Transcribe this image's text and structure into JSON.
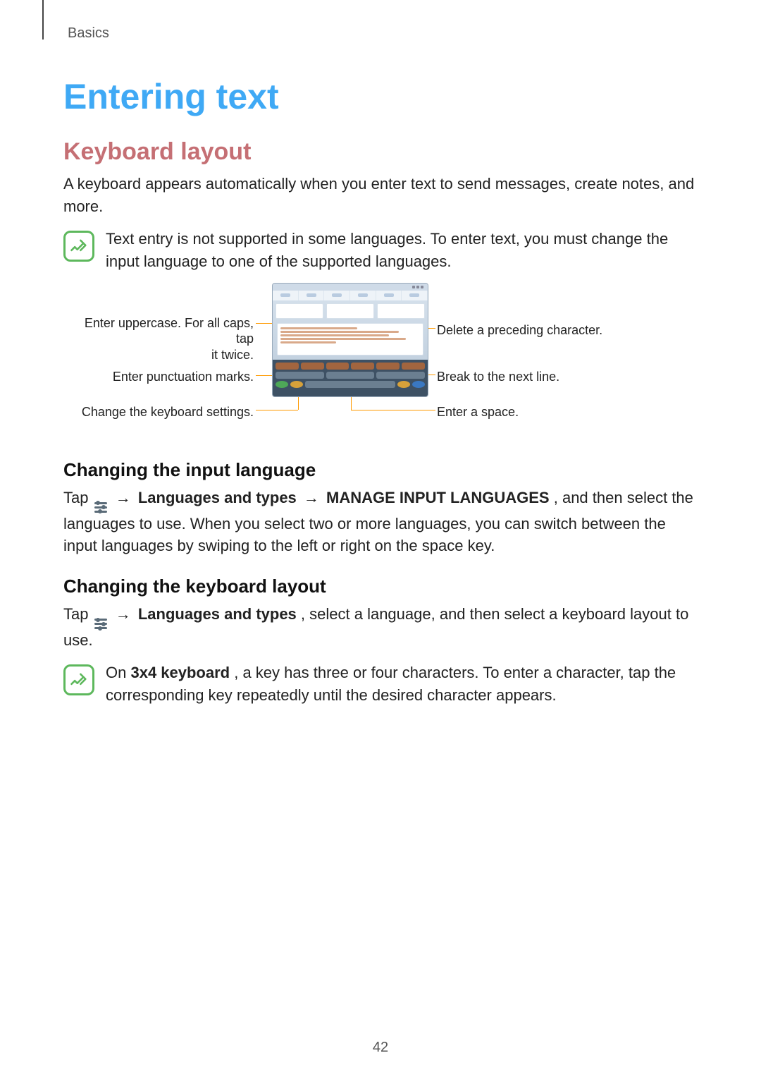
{
  "breadcrumb": "Basics",
  "page_number": "42",
  "title": "Entering text",
  "section1": {
    "heading": "Keyboard layout",
    "intro": "A keyboard appears automatically when you enter text to send messages, create notes, and more.",
    "note": "Text entry is not supported in some languages. To enter text, you must change the input language to one of the supported languages."
  },
  "diagram": {
    "left": {
      "uppercase": "Enter uppercase. For all caps, tap\nit twice.",
      "punctuation": "Enter punctuation marks.",
      "settings": "Change the keyboard settings."
    },
    "right": {
      "delete": "Delete a preceding character.",
      "nextline": "Break to the next line.",
      "space": "Enter a space."
    }
  },
  "sub1": {
    "heading": "Changing the input language",
    "tap": "Tap ",
    "arrow": " → ",
    "bold1": "Languages and types",
    "bold2": "MANAGE INPUT LANGUAGES",
    "rest": ", and then select the languages to use. When you select two or more languages, you can switch between the input languages by swiping to the left or right on the space key."
  },
  "sub2": {
    "heading": "Changing the keyboard layout",
    "tap": "Tap ",
    "arrow": " → ",
    "bold1": "Languages and types",
    "rest": ", select a language, and then select a keyboard layout to use.",
    "note_prefix": "On ",
    "note_bold": "3x4 keyboard",
    "note_rest": ", a key has three or four characters. To enter a character, tap the corresponding key repeatedly until the desired character appears."
  }
}
